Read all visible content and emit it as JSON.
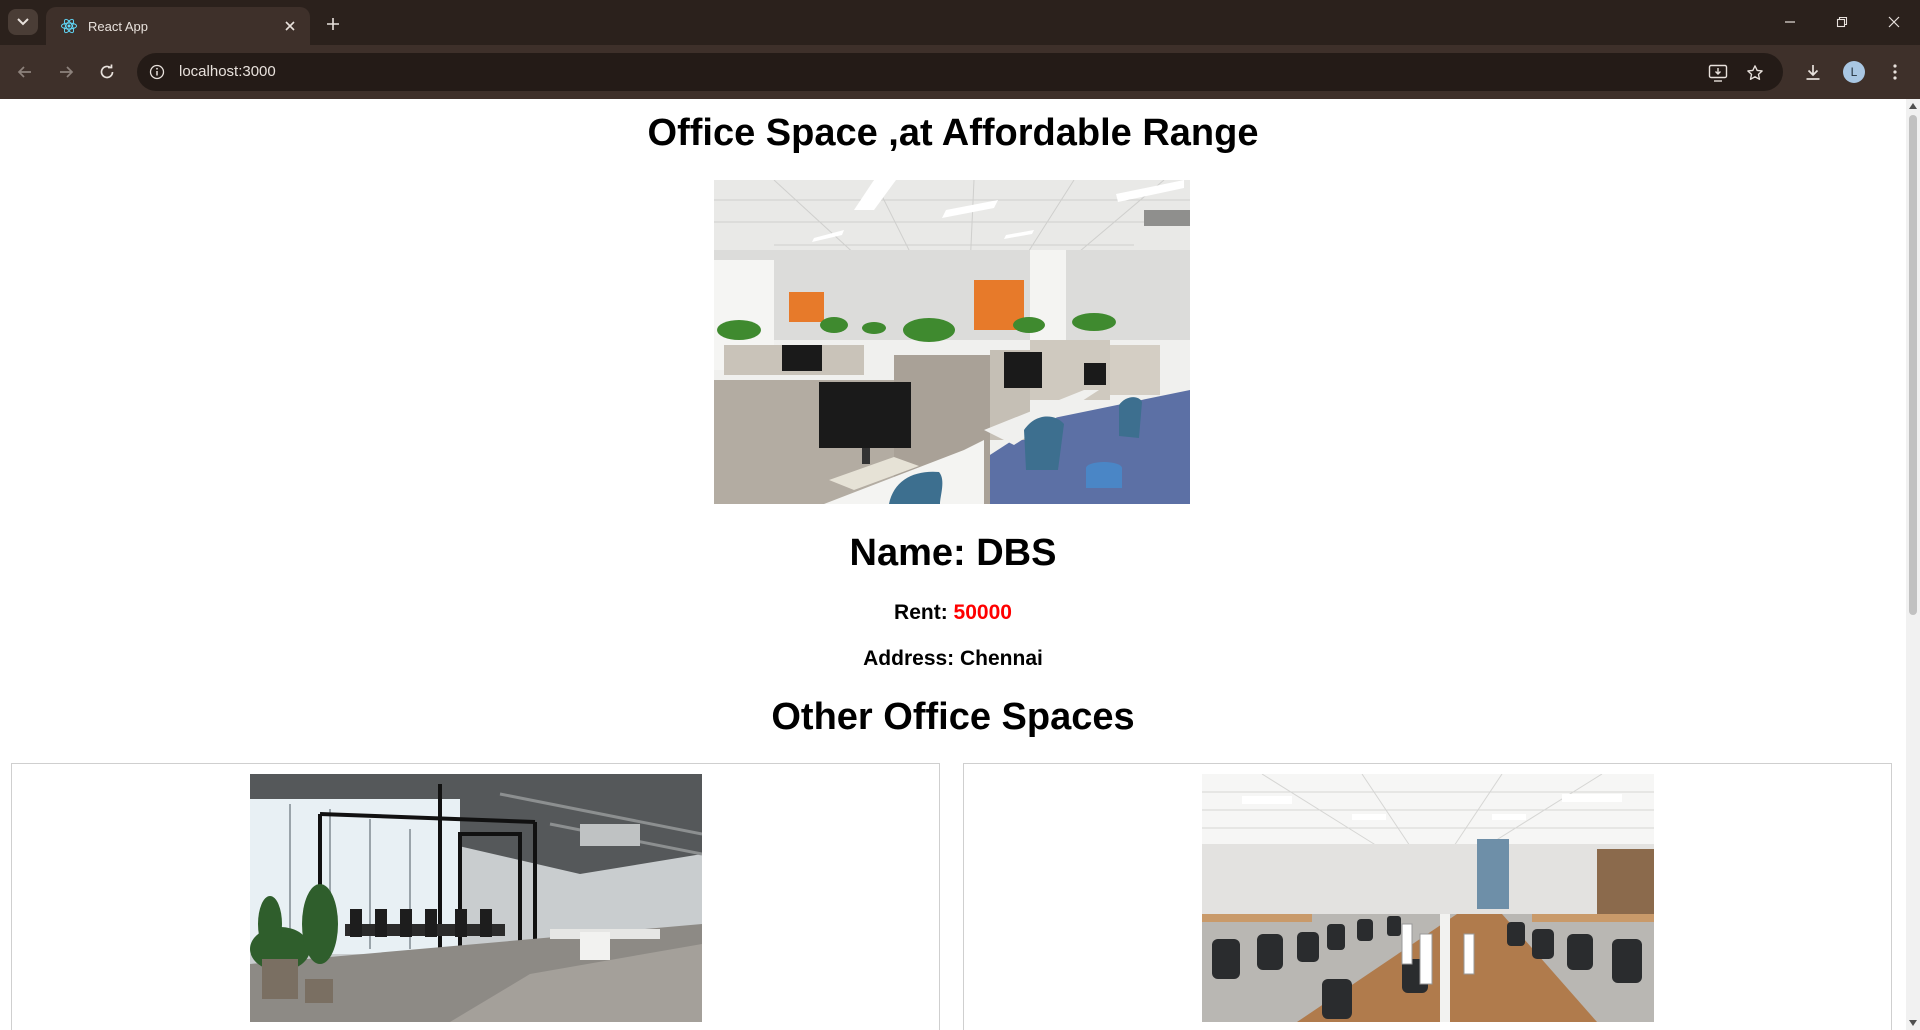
{
  "browser": {
    "tab_title": "React App",
    "url": "localhost:3000",
    "avatar_initial": "L"
  },
  "page": {
    "heading": "Office Space ,at Affordable Range",
    "office": {
      "name_label": "Name: DBS",
      "rent_label": "Rent: ",
      "rent_value": "50000",
      "address_label": "Address: Chennai"
    },
    "other_heading": "Other Office Spaces"
  },
  "colors": {
    "rent_value": "#ff0000",
    "chrome_dark": "#2b211c",
    "chrome_toolbar": "#3e302a"
  }
}
